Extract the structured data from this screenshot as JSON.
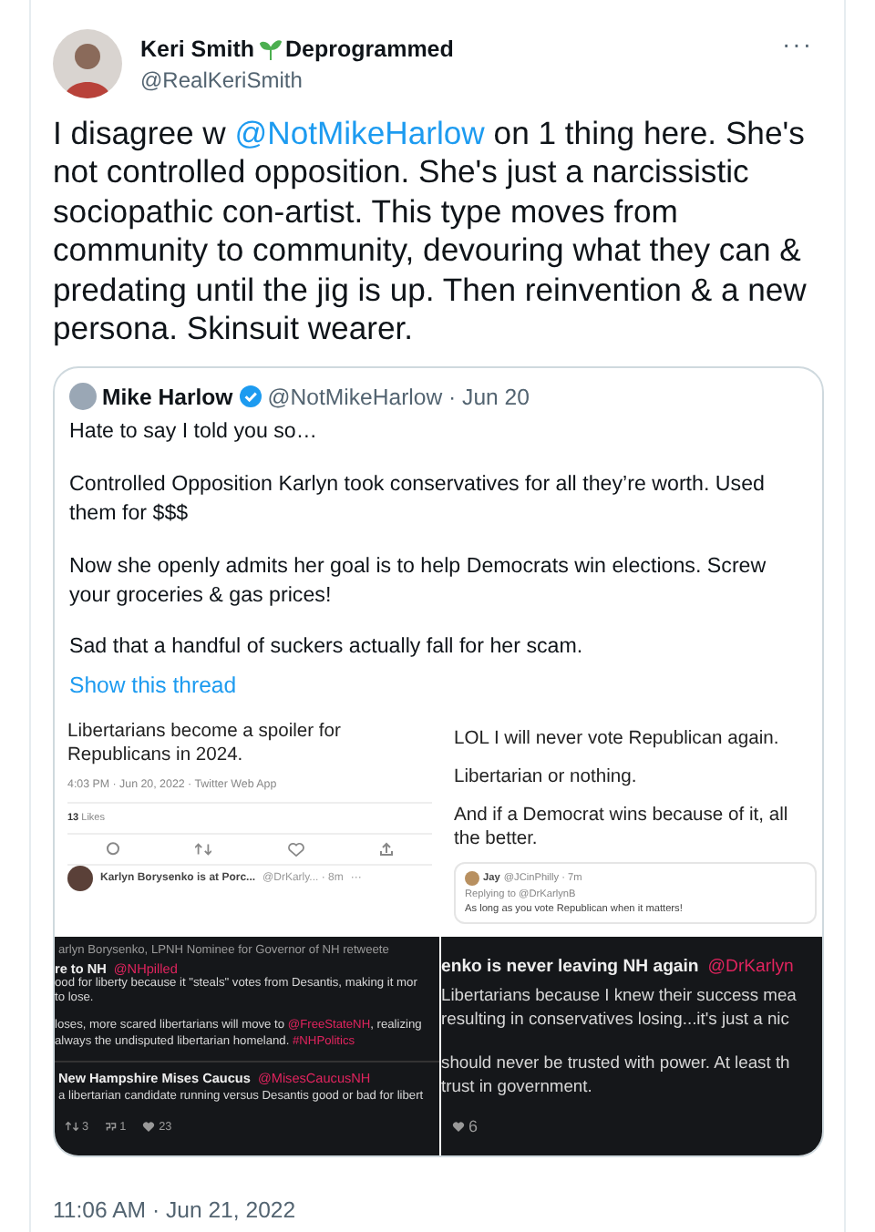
{
  "tweet": {
    "author": {
      "name": "Keri Smith",
      "name_suffix": "Deprogrammed",
      "handle": "@RealKeriSmith"
    },
    "more": "···",
    "text": [
      {
        "kind": "text",
        "text": "I disagree w "
      },
      {
        "kind": "mention",
        "text": "@NotMikeHarlow"
      },
      {
        "kind": "text",
        "text": " on 1 thing here. She's not controlled opposition. She's just a narcissistic sociopathic con-artist. This type moves from community to community, devouring what they can & predating until the jig is up. Then reinvention & a new persona. Skinsuit wearer."
      }
    ],
    "quote": {
      "name": "Mike Harlow",
      "verified": true,
      "handle_date": "@NotMikeHarlow · Jun 20",
      "paragraphs": [
        "Hate to say I told you so…",
        "Controlled Opposition Karlyn took conservatives for all they’re worth. Used them for $$$",
        "Now she openly admits her goal is to help Democrats win elections. Screw your groceries & gas prices!",
        "Sad that a handful of suckers actually fall for her scam."
      ],
      "show_thread": "Show this thread",
      "collage": {
        "top_left": {
          "text": "Libertarians become a spoiler for Republicans in 2024.",
          "meta": "4:03 PM · Jun 20, 2022 · Twitter Web App",
          "likes_count": "13",
          "likes_label": "Likes",
          "reply": {
            "name": "Karlyn Borysenko is at Porc...",
            "handle_time": "@DrKarly... · 8m",
            "more": "···"
          }
        },
        "top_right": {
          "paragraphs": [
            "LOL I will never vote Republican again.",
            "Libertarian or nothing.",
            "And if a Democrat wins because of it, all the better."
          ],
          "quote": {
            "name": "Jay",
            "handle_time": "@JCinPhilly · 7m",
            "replying": "Replying to @DrKarlynB",
            "text": "As long as you vote Republican when it matters!"
          }
        },
        "bottom_left": {
          "retweet": "arlyn Borysenko, LPNH Nominee for Governor of NH retweete",
          "author": {
            "name": "re to NH",
            "handle": "@NHpilled"
          },
          "lines": [
            {
              "segments": [
                {
                  "text": "ood for liberty because it \"steals\" votes from Desantis, making it mor",
                  "kind": "text"
                }
              ]
            },
            {
              "segments": [
                {
                  "text": "to lose.",
                  "kind": "text"
                }
              ]
            },
            {
              "segments": [
                {
                  "text": "loses, more scared libertarians will move to ",
                  "kind": "text"
                },
                {
                  "text": "@FreeStateNH",
                  "kind": "mention"
                },
                {
                  "text": ", realizing",
                  "kind": "text"
                }
              ]
            },
            {
              "segments": [
                {
                  "text": "always the undisputed libertarian homeland. ",
                  "kind": "text"
                },
                {
                  "text": "#NHPolitics",
                  "kind": "hashtag"
                }
              ]
            }
          ],
          "quote": {
            "name": "New Hampshire Mises Caucus",
            "handle": "@MisesCaucusNH",
            "text": "a libertarian candidate running versus Desantis good or bad for libert"
          },
          "stats": [
            {
              "kind": "retweet",
              "count": "3"
            },
            {
              "kind": "quote",
              "count": "1"
            },
            {
              "kind": "like",
              "count": "23"
            }
          ]
        },
        "bottom_right": {
          "author": {
            "name": "enko is never leaving NH again",
            "handle": "@DrKarlyn"
          },
          "lines": [
            "Libertarians because I knew their success mea",
            "resulting in conservatives losing...it's just a nic",
            "should never be trusted with power. At least th",
            "trust in government."
          ],
          "stats": [
            {
              "kind": "like",
              "count": "6"
            }
          ]
        }
      }
    },
    "timestamp": "11:06 AM · Jun 21, 2022"
  }
}
